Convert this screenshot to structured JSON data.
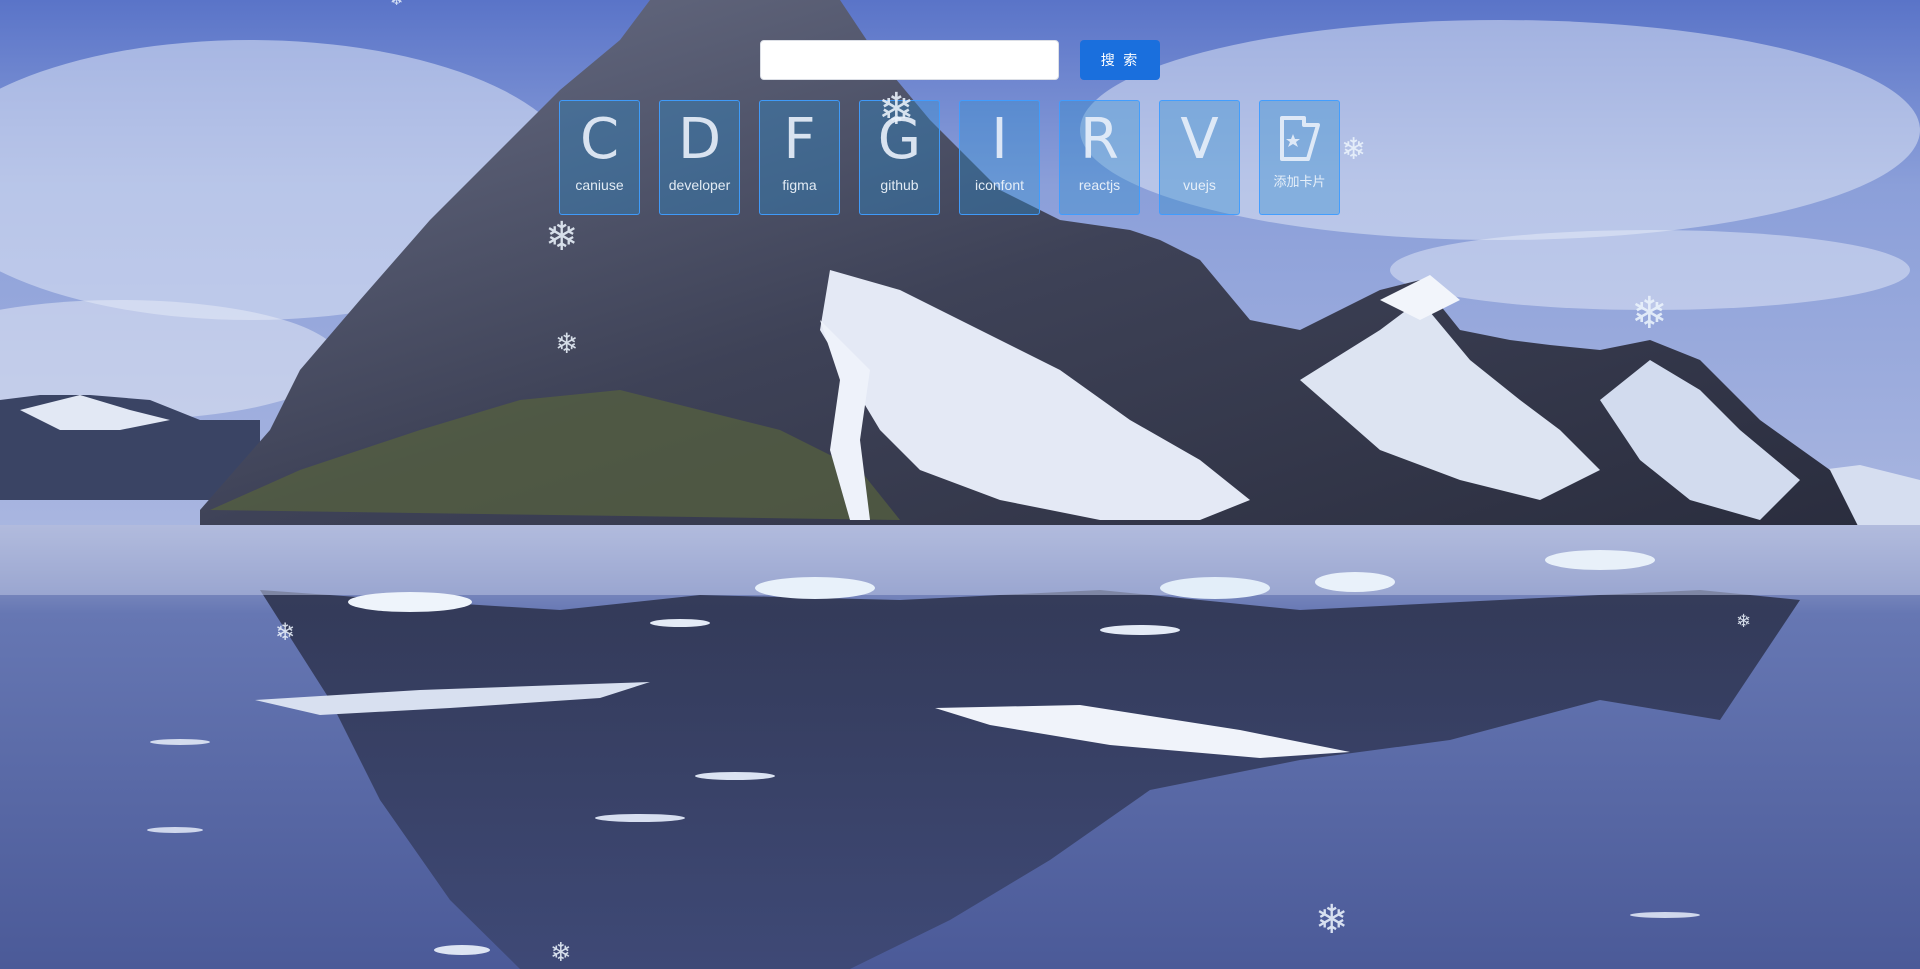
{
  "search": {
    "placeholder": "",
    "value": "",
    "button_label": "搜 索"
  },
  "cards": [
    {
      "letter": "C",
      "label": "caniuse"
    },
    {
      "letter": "D",
      "label": "developer"
    },
    {
      "letter": "F",
      "label": "figma"
    },
    {
      "letter": "G",
      "label": "github"
    },
    {
      "letter": "I",
      "label": "iconfont"
    },
    {
      "letter": "R",
      "label": "reactjs"
    },
    {
      "letter": "V",
      "label": "vuejs"
    }
  ],
  "add_card": {
    "label": "添加卡片",
    "icon": "add-card-icon"
  },
  "snowflake_glyph": "❄",
  "colors": {
    "button": "#1a6fdd",
    "card_border": "#409eff",
    "card_fill": "rgba(48,140,205,0.38)"
  }
}
